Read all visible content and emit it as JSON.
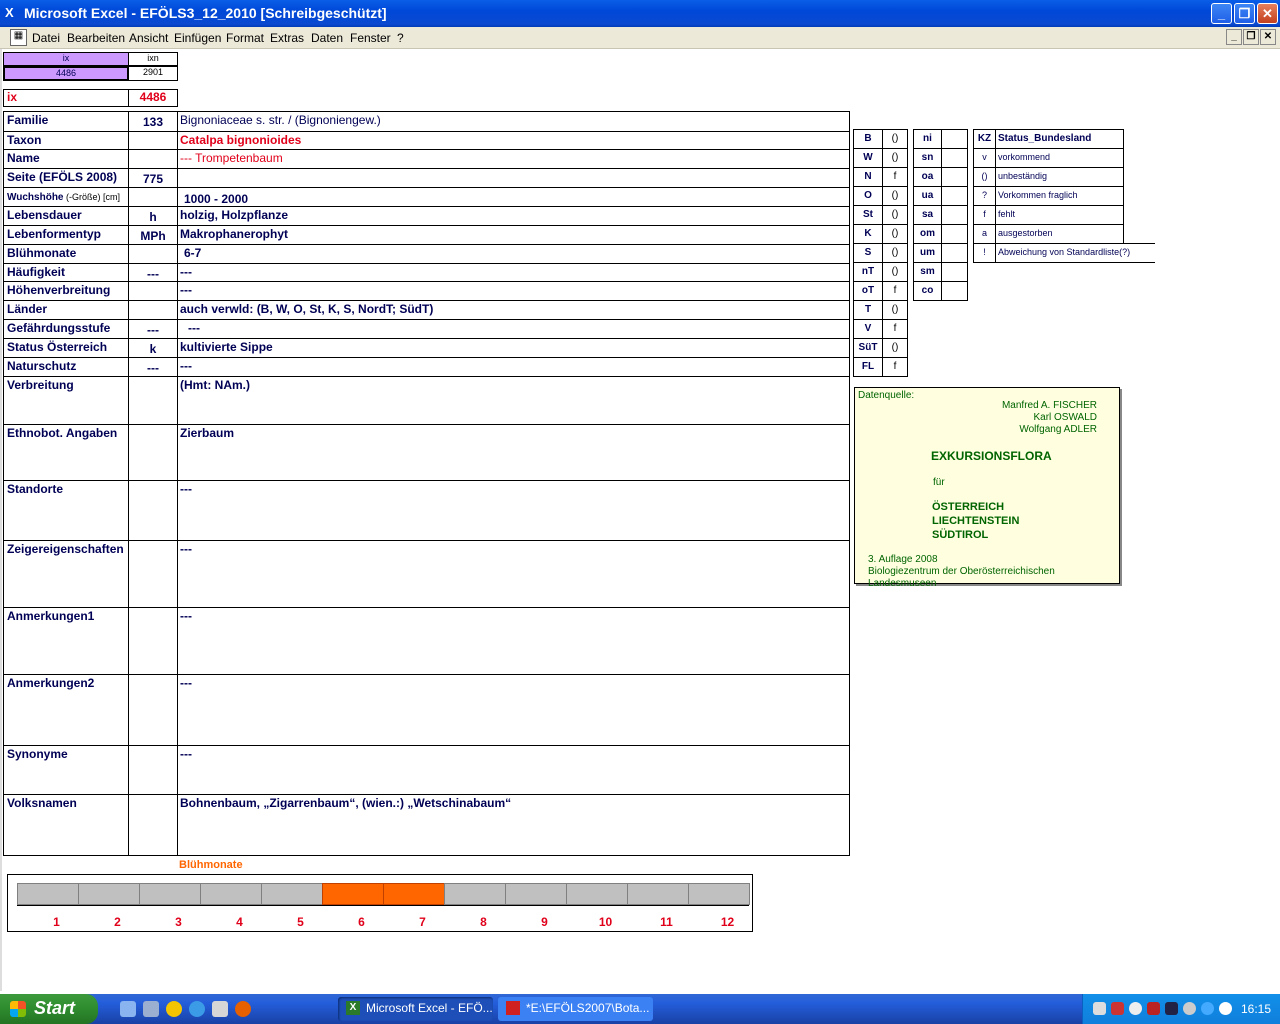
{
  "window": {
    "title": "Microsoft Excel - EFÖLS3_12_2010  [Schreibgeschützt]"
  },
  "menu": [
    "Datei",
    "Bearbeiten",
    "Ansicht",
    "Einfügen",
    "Format",
    "Extras",
    "Daten",
    "Fenster",
    "?"
  ],
  "top_cells": {
    "ix_hdr": "ix",
    "ixn_hdr": "ixn",
    "ix_val": "4486",
    "ixn_val": "2901",
    "ix_label": "ix",
    "ix_value": "4486"
  },
  "rows": [
    {
      "label": "Familie",
      "mid": "133",
      "val": "Bignoniaceae s. str. / (Bignoniengew.)"
    },
    {
      "label": "Taxon",
      "mid": "",
      "val": "Catalpa bignonioides"
    },
    {
      "label": "Name",
      "mid": "",
      "val": "--- Trompetenbaum"
    },
    {
      "label": "Seite (EFÖLS 2008)",
      "mid": "775",
      "val": ""
    },
    {
      "label": "Wuchshöhe",
      "label_suffix": " (-Größe) [cm]",
      "mid": "",
      "val": "1000 - 2000"
    },
    {
      "label": "Lebensdauer",
      "mid": "h",
      "val": "holzig, Holzpflanze"
    },
    {
      "label": "Lebenformentyp",
      "mid": "MPh",
      "val": "Makrophanerophyt"
    },
    {
      "label": "Blühmonate",
      "mid": "",
      "val": "6-7"
    },
    {
      "label": "Häufigkeit",
      "mid": "---",
      "val": "---"
    },
    {
      "label": "Höhenverbreitung",
      "mid": "",
      "val": "---"
    },
    {
      "label": "Länder",
      "mid": "",
      "val": "auch verwld: (B, W, O, St, K, S, NordT; SüdT)"
    },
    {
      "label": "Gefährdungsstufe",
      "mid": "---",
      "val": "---"
    },
    {
      "label": "Status Österreich",
      "mid": "k",
      "val": "kultivierte Sippe"
    },
    {
      "label": "Naturschutz",
      "mid": "---",
      "val": "---"
    },
    {
      "label": "Verbreitung",
      "mid": "",
      "val": "(Hmt: NAm.)"
    },
    {
      "label": "Ethnobot. Angaben",
      "mid": "",
      "val": "Zierbaum"
    },
    {
      "label": "Standorte",
      "mid": "",
      "val": "---"
    },
    {
      "label": "Zeigereigenschaften",
      "mid": "",
      "val": "---"
    },
    {
      "label": "Anmerkungen1",
      "mid": "",
      "val": "---"
    },
    {
      "label": "Anmerkungen2",
      "mid": "",
      "val": "---"
    },
    {
      "label": "Synonyme",
      "mid": "",
      "val": "---"
    },
    {
      "label": "Volksnamen",
      "mid": "",
      "val": "Bohnenbaum, „Zigarrenbaum“, (wien.:) „Wetschinabaum“"
    }
  ],
  "states": [
    {
      "code": "B",
      "val": "()"
    },
    {
      "code": "W",
      "val": "()"
    },
    {
      "code": "N",
      "val": "f"
    },
    {
      "code": "O",
      "val": "()"
    },
    {
      "code": "St",
      "val": "()"
    },
    {
      "code": "K",
      "val": "()"
    },
    {
      "code": "S",
      "val": "()"
    },
    {
      "code": "nT",
      "val": "()"
    },
    {
      "code": "oT",
      "val": "f"
    },
    {
      "code": "T",
      "val": "()"
    },
    {
      "code": "V",
      "val": "f"
    },
    {
      "code": "SüT",
      "val": "()"
    },
    {
      "code": "FL",
      "val": "f"
    }
  ],
  "regions": [
    "ni",
    "sn",
    "oa",
    "ua",
    "sa",
    "om",
    "um",
    "sm",
    "co"
  ],
  "legend": {
    "hdr_code": "KZ",
    "hdr_label": "Status_Bundesland",
    "items": [
      {
        "code": "v",
        "label": "vorkommend"
      },
      {
        "code": "()",
        "label": "unbeständig"
      },
      {
        "code": "?",
        "label": "Vorkommen fraglich"
      },
      {
        "code": "f",
        "label": "fehlt"
      },
      {
        "code": "a",
        "label": "ausgestorben"
      },
      {
        "code": "!",
        "label": "Abweichung von Standardliste(?)"
      }
    ]
  },
  "datenquelle": {
    "heading": "Datenquelle:",
    "authors": [
      "Manfred A. FISCHER",
      "Karl OSWALD",
      "Wolfgang ADLER"
    ],
    "title": "EXKURSIONSFLORA",
    "fuer": "für",
    "countries": [
      "ÖSTERREICH",
      "LIECHTENSTEIN",
      "SÜDTIROL"
    ],
    "edition": "3. Auflage 2008",
    "publisher": "Biologiezentrum der Oberösterreichischen Landesmuseen"
  },
  "chart_data": {
    "type": "bar",
    "title": "Blühmonate",
    "categories": [
      "1",
      "2",
      "3",
      "4",
      "5",
      "6",
      "7",
      "8",
      "9",
      "10",
      "11",
      "12"
    ],
    "values": [
      0,
      0,
      0,
      0,
      0,
      1,
      1,
      0,
      0,
      0,
      0,
      0
    ],
    "colors": {
      "active": "#ff6600",
      "inactive": "#c0c0c0"
    }
  },
  "taskbar": {
    "start": "Start",
    "buttons": [
      "Microsoft Excel - EFÖ...",
      "*E:\\EFÖLS2007\\Bota..."
    ],
    "clock": "16:15"
  }
}
